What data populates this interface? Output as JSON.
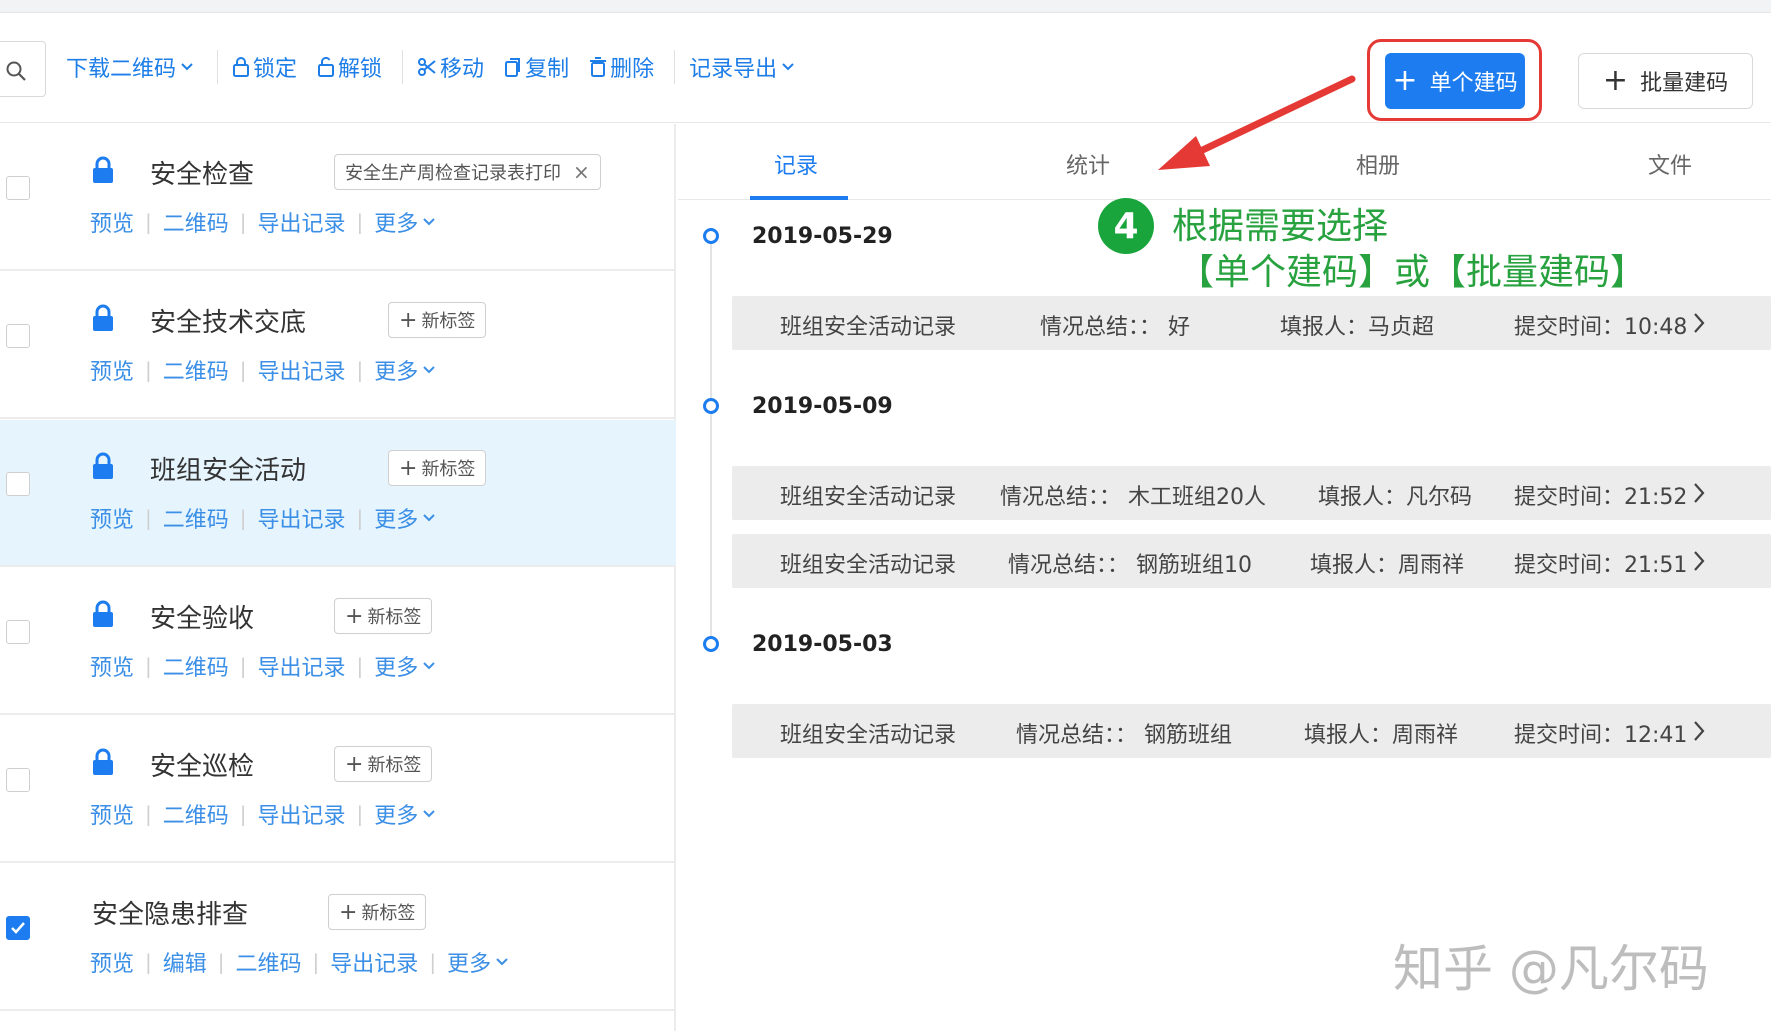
{
  "toolbar": {
    "download_qr": "下载二维码",
    "lock": "锁定",
    "unlock": "解锁",
    "move": "移动",
    "copy": "复制",
    "delete": "删除",
    "export_records": "记录导出",
    "single_code": "单个建码",
    "batch_code": "批量建码"
  },
  "list": [
    {
      "title": "安全检查",
      "tag": "安全生产周检查记录表打印",
      "links": [
        "预览",
        "二维码",
        "导出记录",
        "更多"
      ],
      "checked": false,
      "locked": true
    },
    {
      "title": "安全技术交底",
      "tag": "新标签",
      "links": [
        "预览",
        "二维码",
        "导出记录",
        "更多"
      ],
      "checked": false,
      "locked": true
    },
    {
      "title": "班组安全活动",
      "tag": "新标签",
      "links": [
        "预览",
        "二维码",
        "导出记录",
        "更多"
      ],
      "checked": false,
      "locked": true
    },
    {
      "title": "安全验收",
      "tag": "新标签",
      "links": [
        "预览",
        "二维码",
        "导出记录",
        "更多"
      ],
      "checked": false,
      "locked": true
    },
    {
      "title": "安全巡检",
      "tag": "新标签",
      "links": [
        "预览",
        "二维码",
        "导出记录",
        "更多"
      ],
      "checked": false,
      "locked": true
    },
    {
      "title": "安全隐患排查",
      "tag": "新标签",
      "links": [
        "预览",
        "编辑",
        "二维码",
        "导出记录",
        "更多"
      ],
      "checked": true,
      "locked": false
    }
  ],
  "tabs": [
    "记录",
    "统计",
    "相册",
    "文件"
  ],
  "timeline": [
    {
      "date": "2019-05-29",
      "records": [
        {
          "name": "班组安全活动记录",
          "summary": "情况总结：：  好",
          "reporter": "填报人：马贞超",
          "time": "提交时间：10:48"
        }
      ]
    },
    {
      "date": "2019-05-09",
      "records": [
        {
          "name": "班组安全活动记录",
          "summary": "情况总结：：  木工班组20人",
          "reporter": "填报人：凡尔码",
          "time": "提交时间：21:52"
        },
        {
          "name": "班组安全活动记录",
          "summary": "情况总结：：  钢筋班组10",
          "reporter": "填报人：周雨祥",
          "time": "提交时间：21:51"
        }
      ]
    },
    {
      "date": "2019-05-03",
      "records": [
        {
          "name": "班组安全活动记录",
          "summary": "情况总结：：  钢筋班组",
          "reporter": "填报人：周雨祥",
          "time": "提交时间：12:41"
        }
      ]
    }
  ],
  "annotation": {
    "step": "4",
    "line1": "根据需要选择",
    "line2": "【单个建码】或【批量建码】"
  },
  "watermark": "知乎 @凡尔码",
  "colors": {
    "primary": "#1d7df0",
    "link": "#3b8fe6",
    "highlight": "#e53935",
    "annotation": "#27a23f"
  }
}
